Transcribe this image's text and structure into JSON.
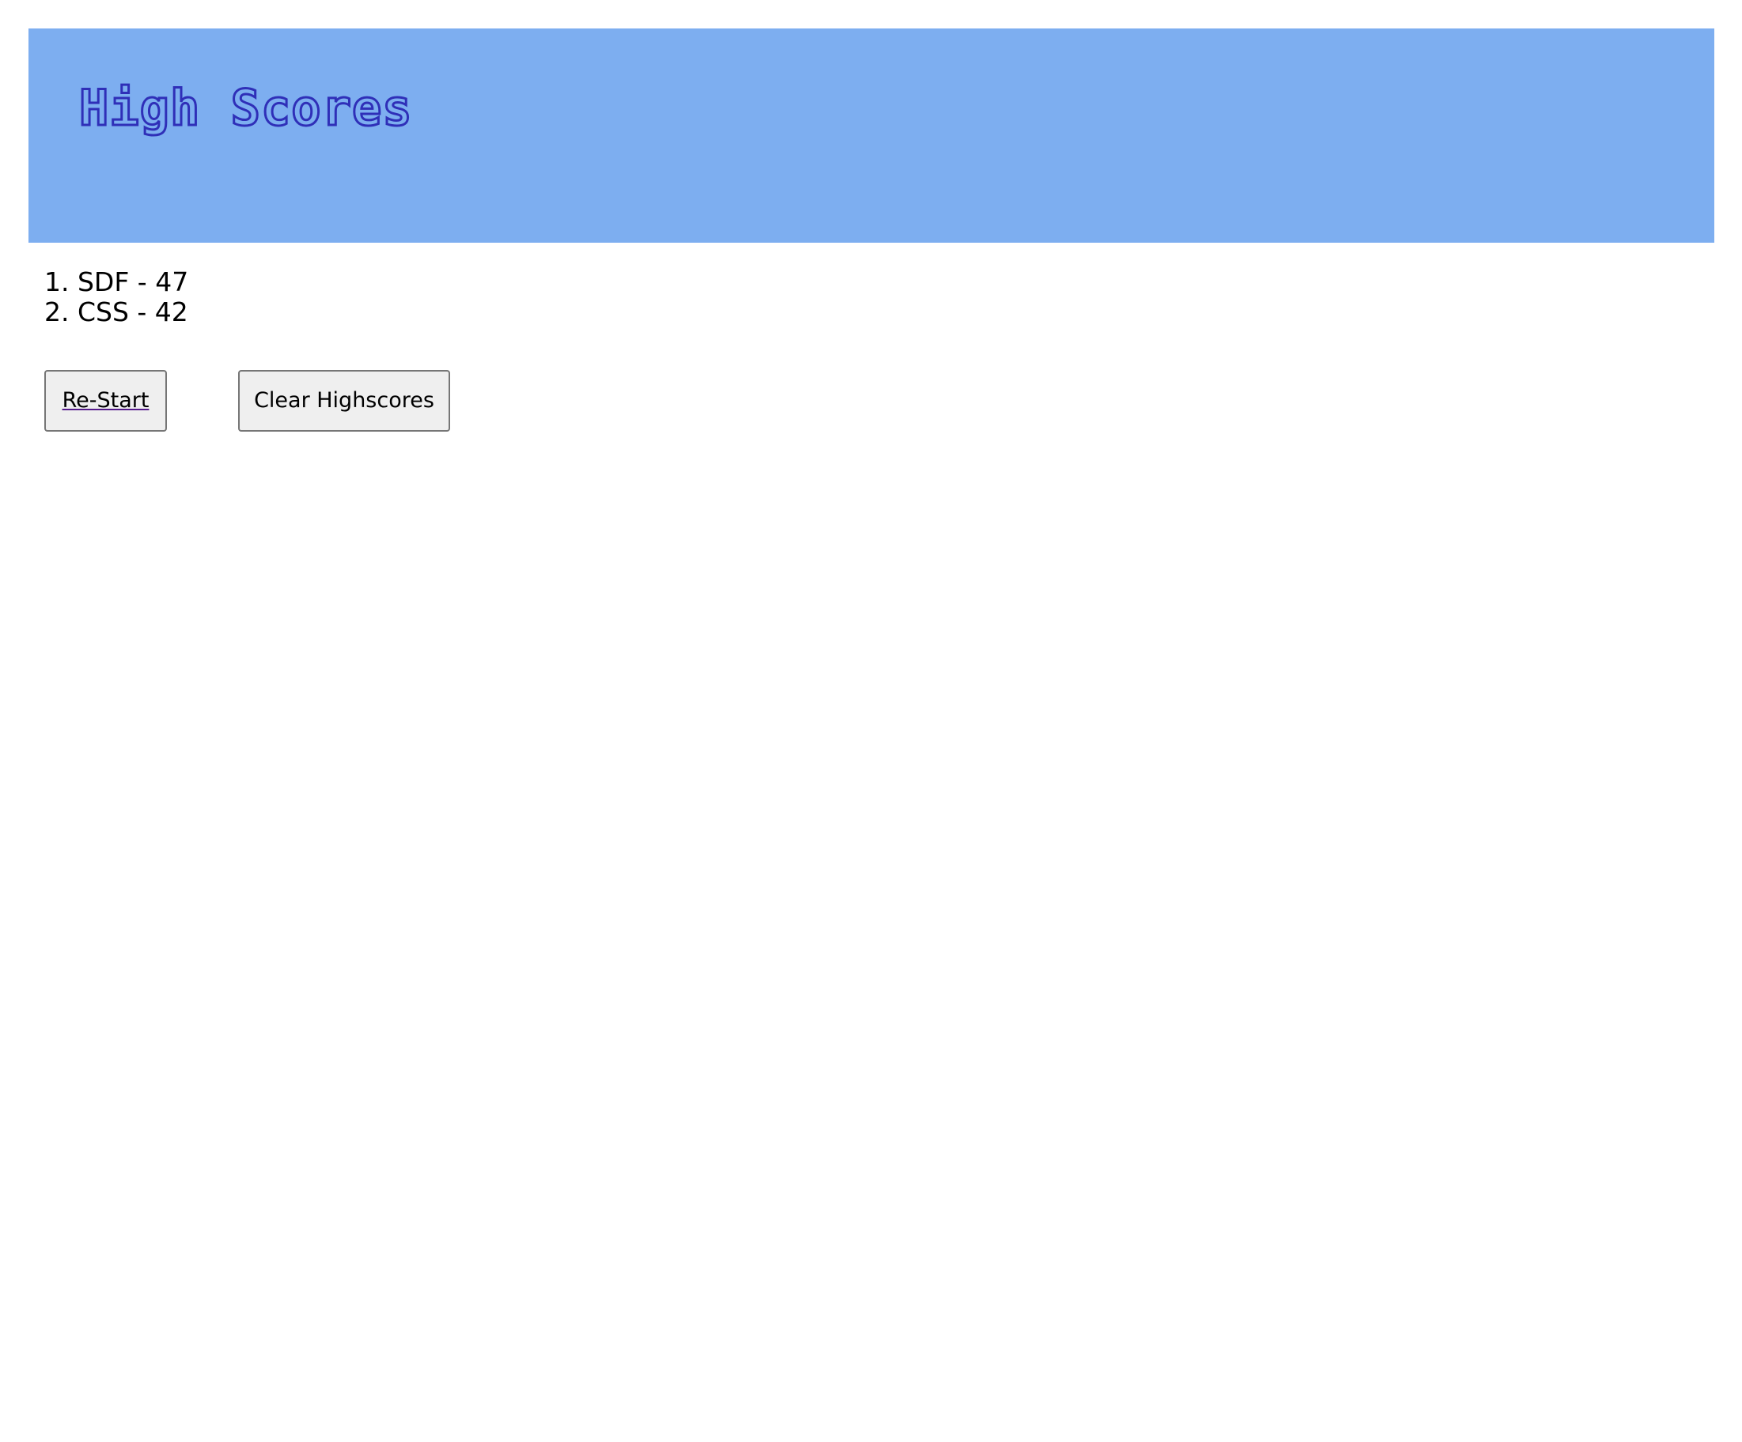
{
  "header": {
    "title": "High Scores",
    "background_color": "#7daef0",
    "title_outline_color": "#2f2fb8"
  },
  "scores": [
    {
      "text": "1. SDF - 47"
    },
    {
      "text": "2. CSS - 42"
    }
  ],
  "actions": {
    "restart_label": "Re-Start",
    "clear_label": "Clear Highscores"
  }
}
